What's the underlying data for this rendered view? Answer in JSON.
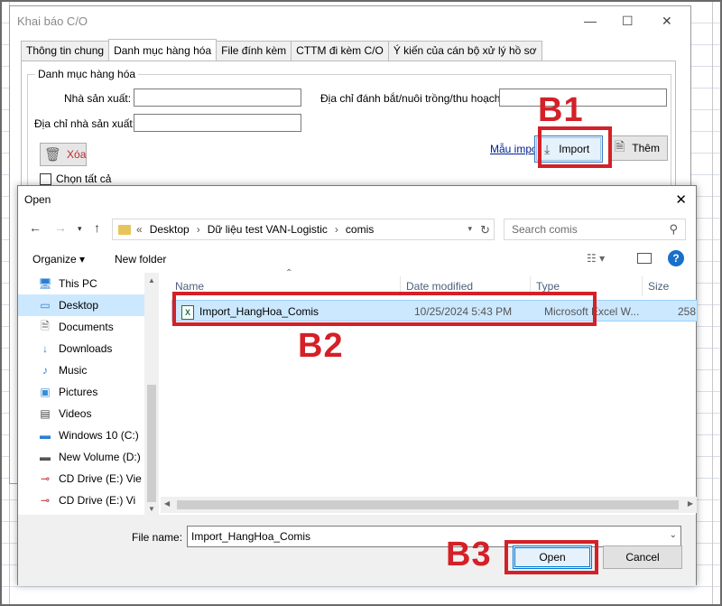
{
  "co_window": {
    "title": "Khai báo C/O",
    "tabs": [
      "Thông tin chung",
      "Danh mục hàng hóa",
      "File đính kèm",
      "CTTM đi kèm C/O",
      "Ý kiến của cán bộ xử lý hồ sơ"
    ],
    "group_title": "Danh mục hàng hóa",
    "label_nha_san_xuat": "Nhà sản xuất:",
    "label_dia_chi_nsx": "Địa chỉ nhà sản xuất:",
    "label_dia_chi_danh_bat": "Địa chỉ đánh bắt/nuôi trồng/thu hoạch:",
    "btn_xoa": "Xóa",
    "chk_chon_tat_ca": "Chọn tất cả",
    "link_mau_import": "Mẫu impor",
    "btn_import": "Import",
    "btn_them": "Thêm"
  },
  "dialog": {
    "title": "Open",
    "breadcrumb": [
      "Desktop",
      "Dữ liệu test VAN-Logistic",
      "comis"
    ],
    "search_placeholder": "Search comis",
    "organize": "Organize ▾",
    "new_folder": "New folder",
    "nav_items": [
      {
        "label": "This PC",
        "icon": "pc-icon"
      },
      {
        "label": "Desktop",
        "icon": "desktop-icon"
      },
      {
        "label": "Documents",
        "icon": "documents-icon"
      },
      {
        "label": "Downloads",
        "icon": "downloads-icon"
      },
      {
        "label": "Music",
        "icon": "music-icon"
      },
      {
        "label": "Pictures",
        "icon": "pictures-icon"
      },
      {
        "label": "Videos",
        "icon": "videos-icon"
      },
      {
        "label": "Windows 10 (C:)",
        "icon": "drive-icon"
      },
      {
        "label": "New Volume (D:)",
        "icon": "drive-icon"
      },
      {
        "label": "CD Drive (E:) Vie",
        "icon": "cd-drive-icon"
      },
      {
        "label": "CD Drive (E:) Vi",
        "icon": "cd-drive-icon"
      }
    ],
    "columns": [
      "Name",
      "Date modified",
      "Type",
      "Size"
    ],
    "file": {
      "name": "Import_HangHoa_Comis",
      "date": "10/25/2024 5:43 PM",
      "type": "Microsoft Excel W...",
      "size": "258"
    },
    "file_name_label": "File name:",
    "file_name_value": "Import_HangHoa_Comis",
    "btn_open": "Open",
    "btn_cancel": "Cancel"
  },
  "annotations": {
    "b1": "B1",
    "b2": "B2",
    "b3": "B3",
    "color": "#d42027"
  }
}
